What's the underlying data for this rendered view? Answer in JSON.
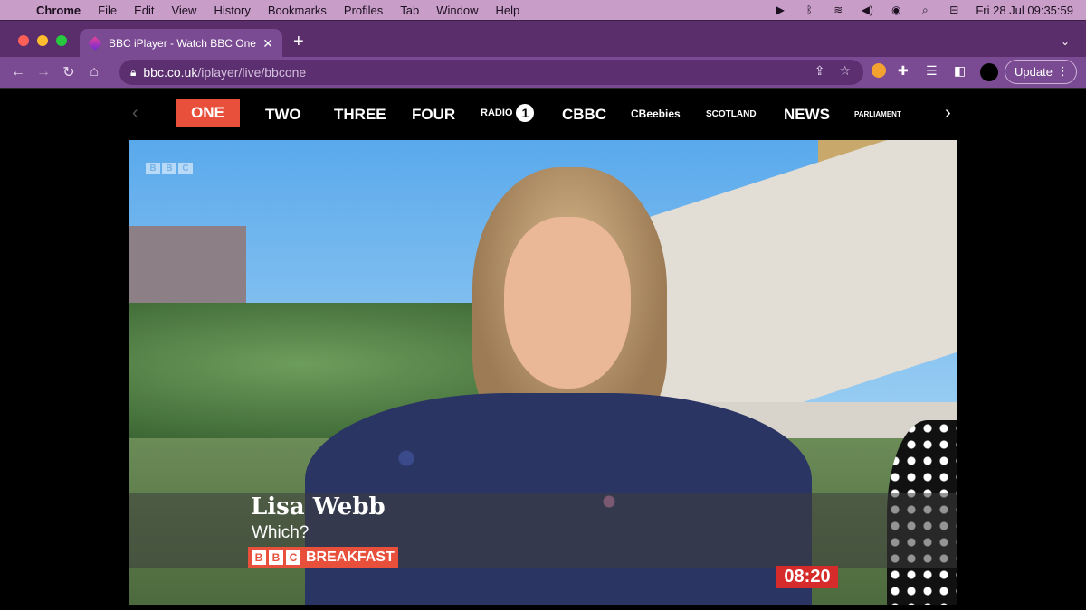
{
  "menubar": {
    "apple": "",
    "items": [
      "Chrome",
      "File",
      "Edit",
      "View",
      "History",
      "Bookmarks",
      "Profiles",
      "Tab",
      "Window",
      "Help"
    ],
    "clock": "Fri 28 Jul  09:35:59"
  },
  "tab": {
    "title": "BBC iPlayer - Watch BBC One l",
    "close": "✕"
  },
  "newtab": "+",
  "omnibox": {
    "host": "bbc.co.uk",
    "path": "/iplayer/live/bbcone"
  },
  "toolbar": {
    "update_label": "Update",
    "update_menu": "⋮"
  },
  "channels": {
    "active": "ONE",
    "two": "TWO",
    "three": "THREE",
    "four": "FOUR",
    "radio_word": "RADIO",
    "radio_num": "1",
    "cbbc": "CBBC",
    "cbeebies": "CBeebies",
    "scotland": "SCOTLAND",
    "news": "NEWS",
    "parliament": "PARLIAMENT"
  },
  "video": {
    "watermark": [
      "B",
      "B",
      "C"
    ],
    "caption_name": "Lisa Webb",
    "caption_role": "Which?",
    "brand_blocks": [
      "B",
      "B",
      "C"
    ],
    "brand_word": "BREAKFAST",
    "time": "08:20"
  }
}
